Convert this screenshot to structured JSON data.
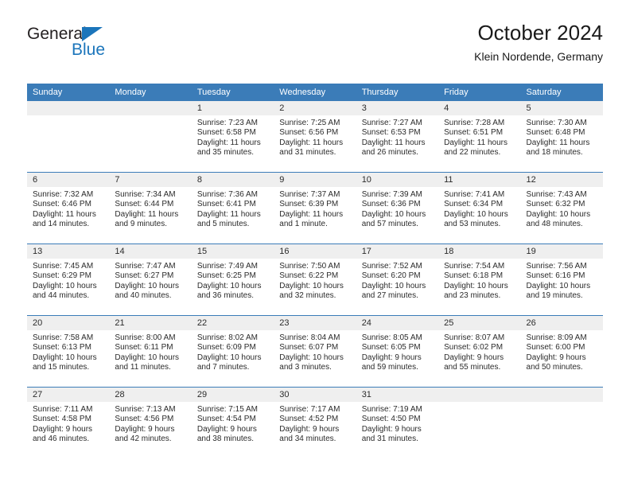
{
  "brand": {
    "name_top": "General",
    "name_bottom": "Blue",
    "accent_color": "#1b75bb"
  },
  "header": {
    "title": "October 2024",
    "subtitle": "Klein Nordende, Germany"
  },
  "theme": {
    "header_blue": "#3b7cb8",
    "day_band_gray": "#efefef",
    "text_color": "#2b2b2b"
  },
  "weekdays": [
    "Sunday",
    "Monday",
    "Tuesday",
    "Wednesday",
    "Thursday",
    "Friday",
    "Saturday"
  ],
  "labels": {
    "sunrise_prefix": "Sunrise:",
    "sunset_prefix": "Sunset:",
    "daylight_prefix": "Daylight:"
  },
  "weeks": [
    [
      {
        "day": "",
        "sunrise": "",
        "sunset": "",
        "daylight_line1": "",
        "daylight_line2": "",
        "empty": true
      },
      {
        "day": "",
        "sunrise": "",
        "sunset": "",
        "daylight_line1": "",
        "daylight_line2": "",
        "empty": true
      },
      {
        "day": "1",
        "sunrise": "Sunrise: 7:23 AM",
        "sunset": "Sunset: 6:58 PM",
        "daylight_line1": "Daylight: 11 hours",
        "daylight_line2": "and 35 minutes."
      },
      {
        "day": "2",
        "sunrise": "Sunrise: 7:25 AM",
        "sunset": "Sunset: 6:56 PM",
        "daylight_line1": "Daylight: 11 hours",
        "daylight_line2": "and 31 minutes."
      },
      {
        "day": "3",
        "sunrise": "Sunrise: 7:27 AM",
        "sunset": "Sunset: 6:53 PM",
        "daylight_line1": "Daylight: 11 hours",
        "daylight_line2": "and 26 minutes."
      },
      {
        "day": "4",
        "sunrise": "Sunrise: 7:28 AM",
        "sunset": "Sunset: 6:51 PM",
        "daylight_line1": "Daylight: 11 hours",
        "daylight_line2": "and 22 minutes."
      },
      {
        "day": "5",
        "sunrise": "Sunrise: 7:30 AM",
        "sunset": "Sunset: 6:48 PM",
        "daylight_line1": "Daylight: 11 hours",
        "daylight_line2": "and 18 minutes."
      }
    ],
    [
      {
        "day": "6",
        "sunrise": "Sunrise: 7:32 AM",
        "sunset": "Sunset: 6:46 PM",
        "daylight_line1": "Daylight: 11 hours",
        "daylight_line2": "and 14 minutes."
      },
      {
        "day": "7",
        "sunrise": "Sunrise: 7:34 AM",
        "sunset": "Sunset: 6:44 PM",
        "daylight_line1": "Daylight: 11 hours",
        "daylight_line2": "and 9 minutes."
      },
      {
        "day": "8",
        "sunrise": "Sunrise: 7:36 AM",
        "sunset": "Sunset: 6:41 PM",
        "daylight_line1": "Daylight: 11 hours",
        "daylight_line2": "and 5 minutes."
      },
      {
        "day": "9",
        "sunrise": "Sunrise: 7:37 AM",
        "sunset": "Sunset: 6:39 PM",
        "daylight_line1": "Daylight: 11 hours",
        "daylight_line2": "and 1 minute."
      },
      {
        "day": "10",
        "sunrise": "Sunrise: 7:39 AM",
        "sunset": "Sunset: 6:36 PM",
        "daylight_line1": "Daylight: 10 hours",
        "daylight_line2": "and 57 minutes."
      },
      {
        "day": "11",
        "sunrise": "Sunrise: 7:41 AM",
        "sunset": "Sunset: 6:34 PM",
        "daylight_line1": "Daylight: 10 hours",
        "daylight_line2": "and 53 minutes."
      },
      {
        "day": "12",
        "sunrise": "Sunrise: 7:43 AM",
        "sunset": "Sunset: 6:32 PM",
        "daylight_line1": "Daylight: 10 hours",
        "daylight_line2": "and 48 minutes."
      }
    ],
    [
      {
        "day": "13",
        "sunrise": "Sunrise: 7:45 AM",
        "sunset": "Sunset: 6:29 PM",
        "daylight_line1": "Daylight: 10 hours",
        "daylight_line2": "and 44 minutes."
      },
      {
        "day": "14",
        "sunrise": "Sunrise: 7:47 AM",
        "sunset": "Sunset: 6:27 PM",
        "daylight_line1": "Daylight: 10 hours",
        "daylight_line2": "and 40 minutes."
      },
      {
        "day": "15",
        "sunrise": "Sunrise: 7:49 AM",
        "sunset": "Sunset: 6:25 PM",
        "daylight_line1": "Daylight: 10 hours",
        "daylight_line2": "and 36 minutes."
      },
      {
        "day": "16",
        "sunrise": "Sunrise: 7:50 AM",
        "sunset": "Sunset: 6:22 PM",
        "daylight_line1": "Daylight: 10 hours",
        "daylight_line2": "and 32 minutes."
      },
      {
        "day": "17",
        "sunrise": "Sunrise: 7:52 AM",
        "sunset": "Sunset: 6:20 PM",
        "daylight_line1": "Daylight: 10 hours",
        "daylight_line2": "and 27 minutes."
      },
      {
        "day": "18",
        "sunrise": "Sunrise: 7:54 AM",
        "sunset": "Sunset: 6:18 PM",
        "daylight_line1": "Daylight: 10 hours",
        "daylight_line2": "and 23 minutes."
      },
      {
        "day": "19",
        "sunrise": "Sunrise: 7:56 AM",
        "sunset": "Sunset: 6:16 PM",
        "daylight_line1": "Daylight: 10 hours",
        "daylight_line2": "and 19 minutes."
      }
    ],
    [
      {
        "day": "20",
        "sunrise": "Sunrise: 7:58 AM",
        "sunset": "Sunset: 6:13 PM",
        "daylight_line1": "Daylight: 10 hours",
        "daylight_line2": "and 15 minutes."
      },
      {
        "day": "21",
        "sunrise": "Sunrise: 8:00 AM",
        "sunset": "Sunset: 6:11 PM",
        "daylight_line1": "Daylight: 10 hours",
        "daylight_line2": "and 11 minutes."
      },
      {
        "day": "22",
        "sunrise": "Sunrise: 8:02 AM",
        "sunset": "Sunset: 6:09 PM",
        "daylight_line1": "Daylight: 10 hours",
        "daylight_line2": "and 7 minutes."
      },
      {
        "day": "23",
        "sunrise": "Sunrise: 8:04 AM",
        "sunset": "Sunset: 6:07 PM",
        "daylight_line1": "Daylight: 10 hours",
        "daylight_line2": "and 3 minutes."
      },
      {
        "day": "24",
        "sunrise": "Sunrise: 8:05 AM",
        "sunset": "Sunset: 6:05 PM",
        "daylight_line1": "Daylight: 9 hours",
        "daylight_line2": "and 59 minutes."
      },
      {
        "day": "25",
        "sunrise": "Sunrise: 8:07 AM",
        "sunset": "Sunset: 6:02 PM",
        "daylight_line1": "Daylight: 9 hours",
        "daylight_line2": "and 55 minutes."
      },
      {
        "day": "26",
        "sunrise": "Sunrise: 8:09 AM",
        "sunset": "Sunset: 6:00 PM",
        "daylight_line1": "Daylight: 9 hours",
        "daylight_line2": "and 50 minutes."
      }
    ],
    [
      {
        "day": "27",
        "sunrise": "Sunrise: 7:11 AM",
        "sunset": "Sunset: 4:58 PM",
        "daylight_line1": "Daylight: 9 hours",
        "daylight_line2": "and 46 minutes."
      },
      {
        "day": "28",
        "sunrise": "Sunrise: 7:13 AM",
        "sunset": "Sunset: 4:56 PM",
        "daylight_line1": "Daylight: 9 hours",
        "daylight_line2": "and 42 minutes."
      },
      {
        "day": "29",
        "sunrise": "Sunrise: 7:15 AM",
        "sunset": "Sunset: 4:54 PM",
        "daylight_line1": "Daylight: 9 hours",
        "daylight_line2": "and 38 minutes."
      },
      {
        "day": "30",
        "sunrise": "Sunrise: 7:17 AM",
        "sunset": "Sunset: 4:52 PM",
        "daylight_line1": "Daylight: 9 hours",
        "daylight_line2": "and 34 minutes."
      },
      {
        "day": "31",
        "sunrise": "Sunrise: 7:19 AM",
        "sunset": "Sunset: 4:50 PM",
        "daylight_line1": "Daylight: 9 hours",
        "daylight_line2": "and 31 minutes."
      },
      {
        "day": "",
        "sunrise": "",
        "sunset": "",
        "daylight_line1": "",
        "daylight_line2": "",
        "empty": true
      },
      {
        "day": "",
        "sunrise": "",
        "sunset": "",
        "daylight_line1": "",
        "daylight_line2": "",
        "empty": true
      }
    ]
  ]
}
